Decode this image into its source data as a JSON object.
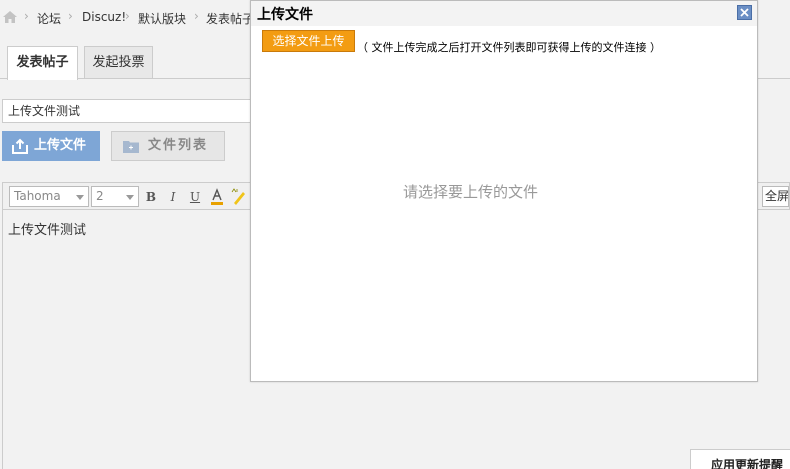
{
  "breadcrumb": {
    "items": [
      "论坛",
      "Discuz!",
      "默认版块",
      "发表帖子"
    ]
  },
  "tabs": [
    {
      "label": "发表帖子"
    },
    {
      "label": "发起投票"
    }
  ],
  "subject": {
    "value": "上传文件测试"
  },
  "upload": {
    "upload_label": "上传文件",
    "list_label": "文件列表"
  },
  "editor": {
    "font_value": "Tahoma",
    "size_value": "2",
    "fullscreen_label": "全屏",
    "content": "上传文件测试"
  },
  "notice": {
    "label": "应用更新提醒"
  },
  "dialog": {
    "title": "上传文件",
    "select_button": "选择文件上传",
    "hint": "（ 文件上传完成之后打开文件列表即可获得上传的文件连接 ）",
    "placeholder": "请选择要上传的文件"
  },
  "colors": {
    "accent_blue": "#7ea6d6",
    "orange_button": "#f39c12",
    "close_icon": "#6b8fc5"
  }
}
